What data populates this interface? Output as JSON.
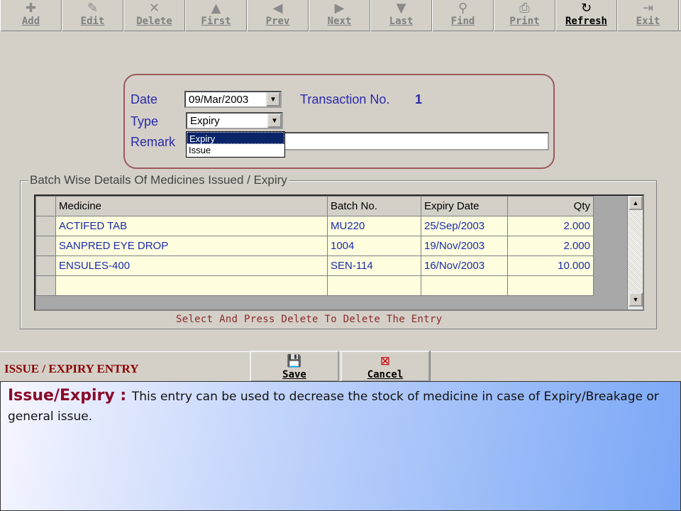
{
  "toolbar": {
    "buttons": [
      {
        "label": "Add",
        "icon": "plus-icon",
        "glyph": "✚"
      },
      {
        "label": "Edit",
        "icon": "edit-icon",
        "glyph": "✎"
      },
      {
        "label": "Delete",
        "icon": "delete-icon",
        "glyph": "✕"
      },
      {
        "label": "First",
        "icon": "first-icon",
        "glyph": "▲"
      },
      {
        "label": "Prev",
        "icon": "prev-icon",
        "glyph": "◀"
      },
      {
        "label": "Next",
        "icon": "next-icon",
        "glyph": "▶"
      },
      {
        "label": "Last",
        "icon": "last-icon",
        "glyph": "▼"
      },
      {
        "label": "Find",
        "icon": "binoculars-icon",
        "glyph": "⚲"
      },
      {
        "label": "Print",
        "icon": "printer-icon",
        "glyph": "⎙"
      },
      {
        "label": "Refresh",
        "icon": "refresh-icon",
        "glyph": "↻"
      },
      {
        "label": "Exit",
        "icon": "exit-icon",
        "glyph": "⇥"
      }
    ]
  },
  "form": {
    "date_label": "Date",
    "date_value": "09/Mar/2003",
    "transaction_label": "Transaction No.",
    "transaction_value": "1",
    "type_label": "Type",
    "type_value": "Expiry",
    "type_options": [
      "Expiry",
      "Issue"
    ],
    "remark_label": "Remark",
    "remark_value": ""
  },
  "grid": {
    "title": "Batch Wise Details Of Medicines Issued / Expiry",
    "columns": [
      "Medicine",
      "Batch No.",
      "Expiry Date",
      "Qty"
    ],
    "rows": [
      [
        "ACTIFED  TAB",
        "MU220",
        "25/Sep/2003",
        "2.000"
      ],
      [
        "SANPRED EYE DROP",
        "1004",
        "19/Nov/2003",
        "2.000"
      ],
      [
        "ENSULES-400",
        "SEN-114",
        "16/Nov/2003",
        "10.000"
      ],
      [
        "",
        "",
        "",
        ""
      ]
    ],
    "hint": "Select And Press Delete To Delete The Entry"
  },
  "footer": {
    "form_title": "ISSUE / EXPIRY ENTRY",
    "save_label": "Save",
    "cancel_label": "Cancel"
  },
  "caption": {
    "heading": "Issue/Expiry : ",
    "body": "This entry can be used to decrease the stock of medicine in case of Expiry/Breakage  or general issue."
  },
  "colors": {
    "label_blue": "#2a2aa8",
    "form_border": "#9a5a5a",
    "grid_cell_bg": "#ffffe0",
    "title_red": "#8a0000"
  }
}
